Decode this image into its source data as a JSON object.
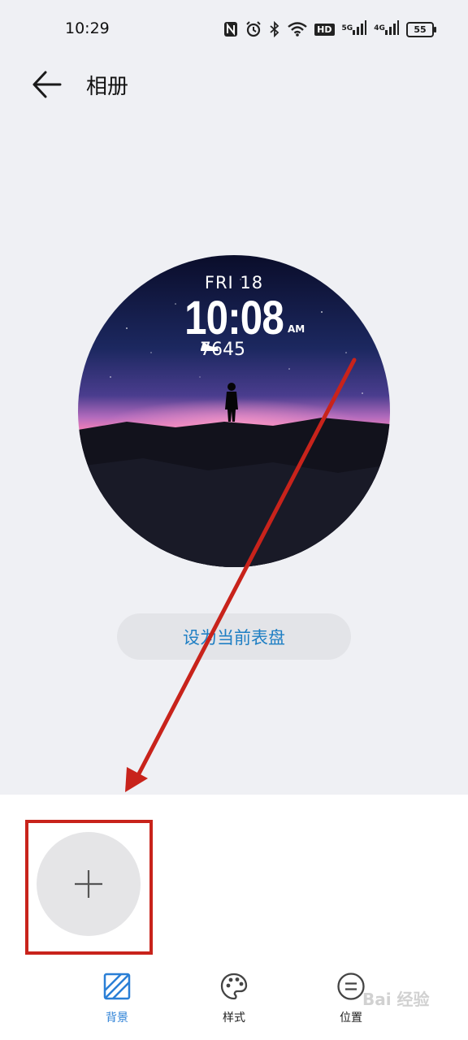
{
  "status_bar": {
    "time": "10:29",
    "battery": "55",
    "hd": "HD",
    "sig1": "5G",
    "sig2": "4G",
    "icons": [
      "nfc-icon",
      "alarm-icon",
      "bluetooth-icon",
      "wifi-icon",
      "hd-icon",
      "signal-5g-icon",
      "signal-4g-icon",
      "battery-icon"
    ]
  },
  "header": {
    "title": "相册",
    "back_icon": "back-arrow-icon"
  },
  "watch_face": {
    "date": "FRI 18",
    "time": "10:08",
    "ampm": "AM",
    "steps": "7645",
    "steps_icon": "shoe-icon"
  },
  "set_button_label": "设为当前表盘",
  "bottom_sheet": {
    "add_icon": "plus-icon",
    "tabs": [
      {
        "label": "背景",
        "icon": "background-icon",
        "active": true
      },
      {
        "label": "样式",
        "icon": "palette-icon",
        "active": false
      },
      {
        "label": "位置",
        "icon": "position-icon",
        "active": false
      }
    ]
  },
  "colors": {
    "accent": "#2a7fd6",
    "button_text": "#1f7fc4",
    "annotation": "#c8231b",
    "background": "#eff0f4"
  },
  "watermark": "Bai 经验"
}
